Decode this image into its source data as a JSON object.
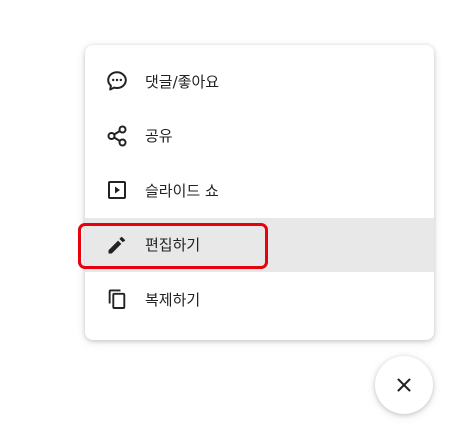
{
  "menu": {
    "items": [
      {
        "label": "댓글/좋아요",
        "icon": "comment-icon"
      },
      {
        "label": "공유",
        "icon": "share-icon"
      },
      {
        "label": "슬라이드 쇼",
        "icon": "slideshow-icon"
      },
      {
        "label": "편집하기",
        "icon": "edit-pencil-icon",
        "active": true
      },
      {
        "label": "복제하기",
        "icon": "copy-icon"
      }
    ]
  },
  "highlight": {
    "color": "#e8000b"
  },
  "close_button": {
    "icon": "close-icon"
  }
}
